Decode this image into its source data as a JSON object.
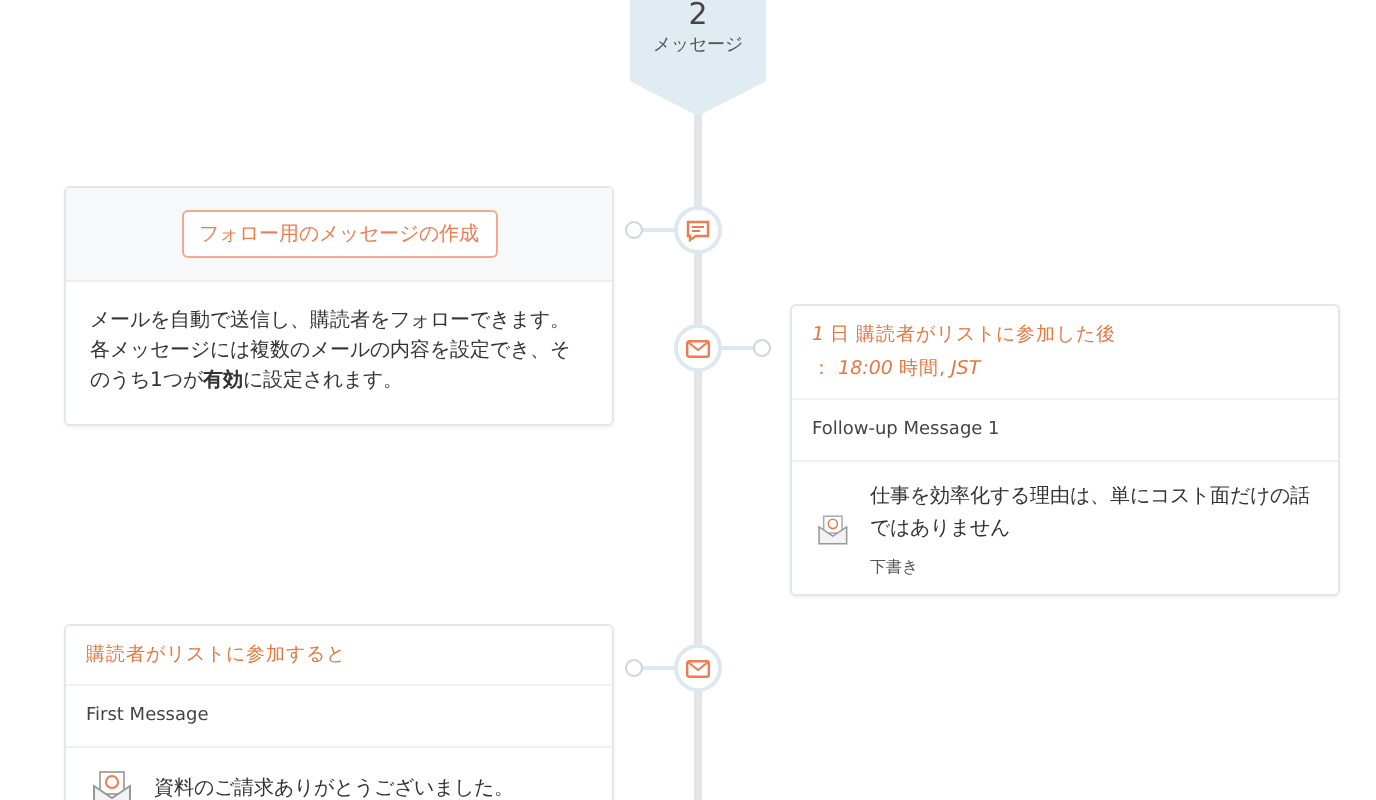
{
  "badge": {
    "number": "2",
    "label": "メッセージ"
  },
  "items": [
    {
      "kind": "intro",
      "button": "フォロー用のメッセージの作成",
      "description": "メールを自動で送信し、購読者をフォローできます。各メッセージには複数のメールの内容を設定でき、そのうち1つが**有効**に設定されます。"
    },
    {
      "kind": "message",
      "trigger": [
        "*1* 日 購読者がリストに参加した後",
        "： *18:00* 時間, *JST*"
      ],
      "name": "Follow-up Message 1",
      "subject": "仕事を効率化する理由は、単にコスト面だけの話ではありません",
      "status": "下書き"
    },
    {
      "kind": "message",
      "trigger": [
        "購読者がリストに参加すると"
      ],
      "name": "First Message",
      "subject": "資料のご請求ありがとうございました。"
    }
  ]
}
